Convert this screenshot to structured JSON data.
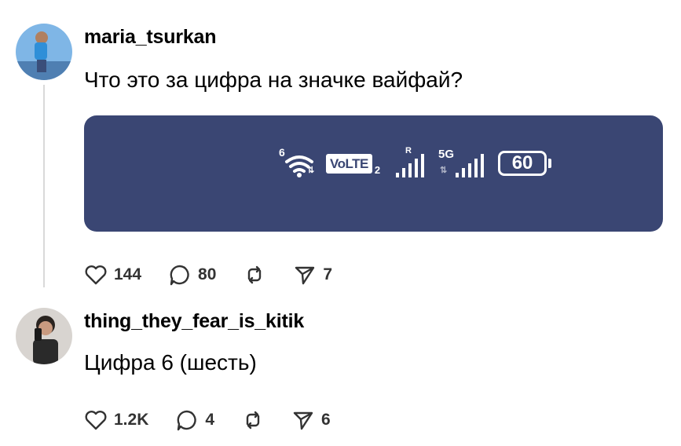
{
  "posts": [
    {
      "username": "maria_tsurkan",
      "text": "Что это за цифра на значке вайфай?",
      "media": {
        "wifi_badge": "6",
        "wifi_arrows": "⇅",
        "volte": "VoLTE",
        "volte_sub": "2",
        "signal1_badge": "R",
        "signal2_badge": "5G",
        "signal2_arrows": "⇅",
        "battery_level": "60"
      },
      "stats": {
        "likes": "144",
        "comments": "80",
        "shares": "7"
      }
    },
    {
      "username": "thing_they_fear_is_kitik",
      "text": "Цифра 6 (шесть)",
      "stats": {
        "likes": "1.2K",
        "comments": "4",
        "shares": "6"
      }
    }
  ],
  "colors": {
    "media_bg": "#3a4673",
    "thread_line": "#d9d9d9",
    "icon": "#333333"
  },
  "icons": [
    "heart-icon",
    "comment-icon",
    "repost-icon",
    "share-icon"
  ]
}
